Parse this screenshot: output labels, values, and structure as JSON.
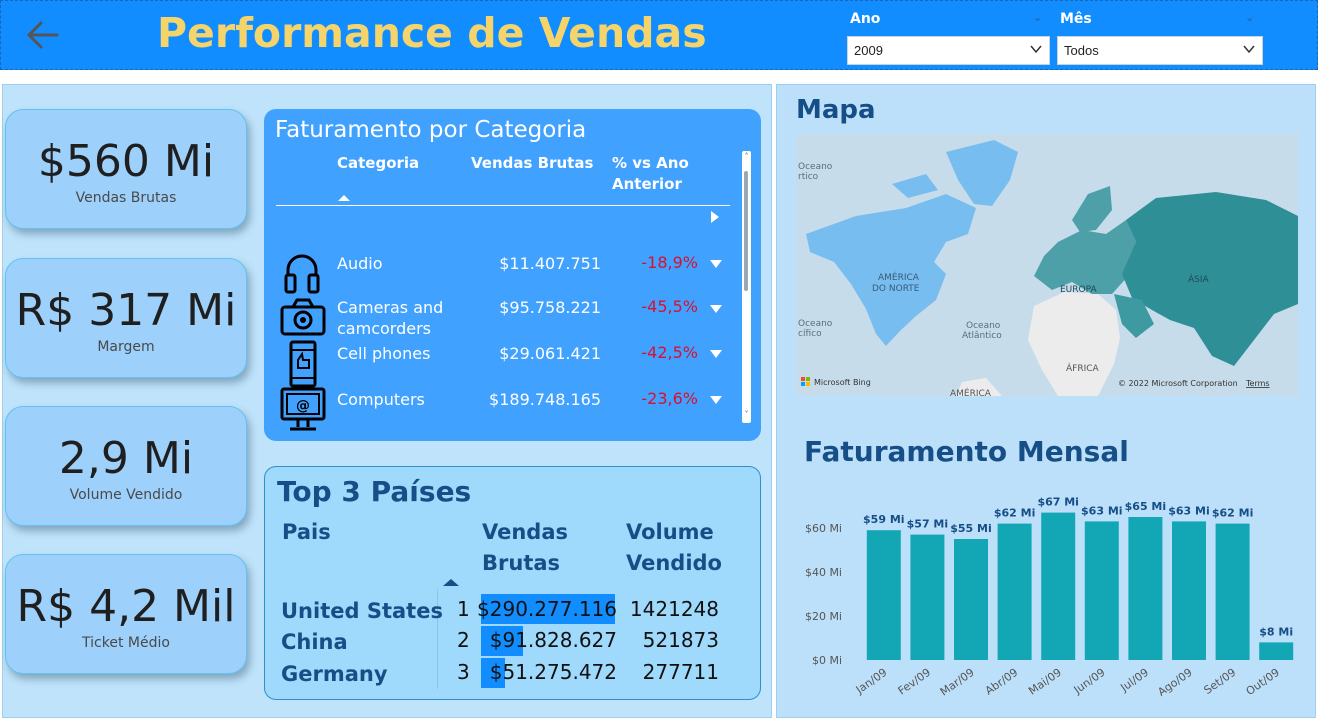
{
  "header": {
    "title": "Performance de Vendas",
    "year_filter": {
      "label": "Ano",
      "value": "2009"
    },
    "month_filter": {
      "label": "Mês",
      "value": "Todos"
    }
  },
  "kpis": [
    {
      "value": "$560 Mi",
      "label": "Vendas Brutas"
    },
    {
      "value": "R$ 317 Mi",
      "label": "Margem"
    },
    {
      "value": "2,9 Mi",
      "label": "Volume Vendido"
    },
    {
      "value": "R$ 4,2 Mil",
      "label": "Ticket Médio"
    }
  ],
  "category_table": {
    "title": "Faturamento por Categoria",
    "headers": {
      "category": "Categoria",
      "sales": "Vendas Brutas",
      "pct": "% vs Ano Anterior"
    },
    "rows": [
      {
        "category": "Audio",
        "sales": "$11.407.751",
        "pct": "-18,9%",
        "icon": "headphones-icon"
      },
      {
        "category": "Cameras and camcorders",
        "sales": "$95.758.221",
        "pct": "-45,5%",
        "icon": "camera-icon"
      },
      {
        "category": "Cell phones",
        "sales": "$29.061.421",
        "pct": "-42,5%",
        "icon": "cell-phone-icon"
      },
      {
        "category": "Computers",
        "sales": "$189.748.165",
        "pct": "-23,6%",
        "icon": "computer-icon"
      }
    ]
  },
  "top_countries": {
    "title": "Top 3 Países",
    "headers": {
      "country": "Pais",
      "sales": "Vendas Brutas",
      "volume": "Volume Vendido"
    },
    "rows": [
      {
        "rank": "1",
        "country": "United States",
        "sales": "$290.277.116",
        "volume": "1421248",
        "sales_value": 290277116
      },
      {
        "rank": "2",
        "country": "China",
        "sales": "$91.828.627",
        "volume": "521873",
        "sales_value": 91828627
      },
      {
        "rank": "3",
        "country": "Germany",
        "sales": "$51.275.472",
        "volume": "277711",
        "sales_value": 51275472
      }
    ]
  },
  "map": {
    "title": "Mapa",
    "labels": {
      "north_america": "AMÉRICA DO NORTE",
      "europe": "EUROPA",
      "asia": "ÁSIA",
      "africa": "ÁFRICA",
      "south_america": "AMÉRICA",
      "atlantic": "Oceano Atlântico",
      "arctic": "Oceano Ártico",
      "pacific": "Oceano Pacífico"
    },
    "attribution": "© 2022 Microsoft Corporation",
    "terms": "Terms",
    "logo": "Microsoft Bing"
  },
  "chart_data": {
    "type": "bar",
    "title": "Faturamento Mensal",
    "categories": [
      "Jan/09",
      "Fev/09",
      "Mar/09",
      "Abr/09",
      "Mai/09",
      "Jun/09",
      "Jul/09",
      "Ago/09",
      "Set/09",
      "Out/09"
    ],
    "values": [
      59,
      57,
      55,
      62,
      67,
      63,
      65,
      63,
      62,
      8
    ],
    "data_labels": [
      "$59 Mi",
      "$57 Mi",
      "$55 Mi",
      "$62 Mi",
      "$67 Mi",
      "$63 Mi",
      "$65 Mi",
      "$63 Mi",
      "$62 Mi",
      "$8 Mi"
    ],
    "yticks": [
      0,
      20,
      40,
      60
    ],
    "ytick_labels": [
      "$0 Mi",
      "$20 Mi",
      "$40 Mi",
      "$60 Mi"
    ],
    "ylim": [
      0,
      70
    ],
    "xlabel": "",
    "ylabel": "",
    "grid": false,
    "color": "#13a7b5"
  },
  "colors": {
    "header": "#118dff",
    "title": "#f5d46b",
    "dark_blue": "#164e87",
    "negative": "#d6122e",
    "bar": "#13a7b5"
  }
}
